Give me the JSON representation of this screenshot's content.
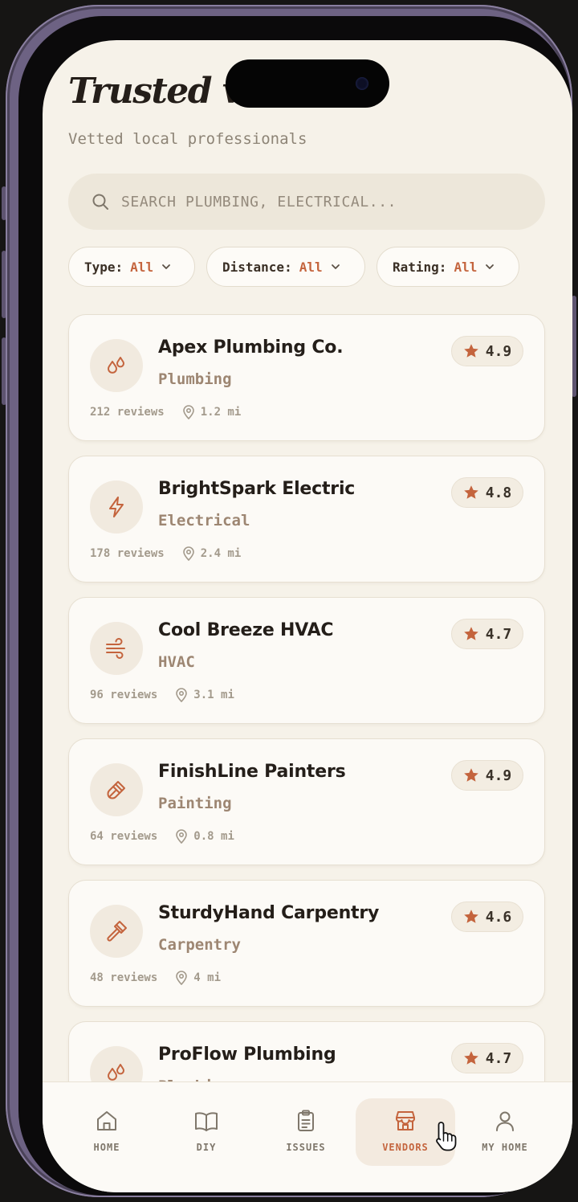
{
  "header": {
    "title": "Trusted vendors",
    "subtitle": "Vetted local professionals"
  },
  "search": {
    "placeholder": "SEARCH PLUMBING, ELECTRICAL...",
    "value": "",
    "icon": "search-icon"
  },
  "filters": [
    {
      "label": "Type:",
      "value": "All"
    },
    {
      "label": "Distance:",
      "value": "All"
    },
    {
      "label": "Rating:",
      "value": "All"
    }
  ],
  "vendors": [
    {
      "name": "Apex Plumbing Co.",
      "category": "Plumbing",
      "reviews": "212 reviews",
      "distance": "1.2 mi",
      "rating": "4.9",
      "icon": "droplets-icon"
    },
    {
      "name": "BrightSpark Electric",
      "category": "Electrical",
      "reviews": "178 reviews",
      "distance": "2.4 mi",
      "rating": "4.8",
      "icon": "lightning-icon"
    },
    {
      "name": "Cool Breeze HVAC",
      "category": "HVAC",
      "reviews": "96 reviews",
      "distance": "3.1 mi",
      "rating": "4.7",
      "icon": "wind-icon"
    },
    {
      "name": "FinishLine Painters",
      "category": "Painting",
      "reviews": "64 reviews",
      "distance": "0.8 mi",
      "rating": "4.9",
      "icon": "paintbrush-icon"
    },
    {
      "name": "SturdyHand Carpentry",
      "category": "Carpentry",
      "reviews": "48 reviews",
      "distance": "4 mi",
      "rating": "4.6",
      "icon": "hammer-icon"
    },
    {
      "name": "ProFlow Plumbing",
      "category": "Plumbing",
      "reviews": "",
      "distance": "",
      "rating": "4.7",
      "icon": "droplets-icon"
    }
  ],
  "tabs": [
    {
      "label": "HOME",
      "icon": "house-icon",
      "active": false
    },
    {
      "label": "DIY",
      "icon": "book-icon",
      "active": false
    },
    {
      "label": "ISSUES",
      "icon": "clipboard-icon",
      "active": false
    },
    {
      "label": "VENDORS",
      "icon": "store-icon",
      "active": true
    },
    {
      "label": "MY HOME",
      "icon": "user-icon",
      "active": false
    }
  ],
  "colors": {
    "accent": "#c4643d",
    "background": "#f6f2e9",
    "card": "#fcfaf6",
    "text": "#241e19",
    "muted": "#9d8672"
  }
}
